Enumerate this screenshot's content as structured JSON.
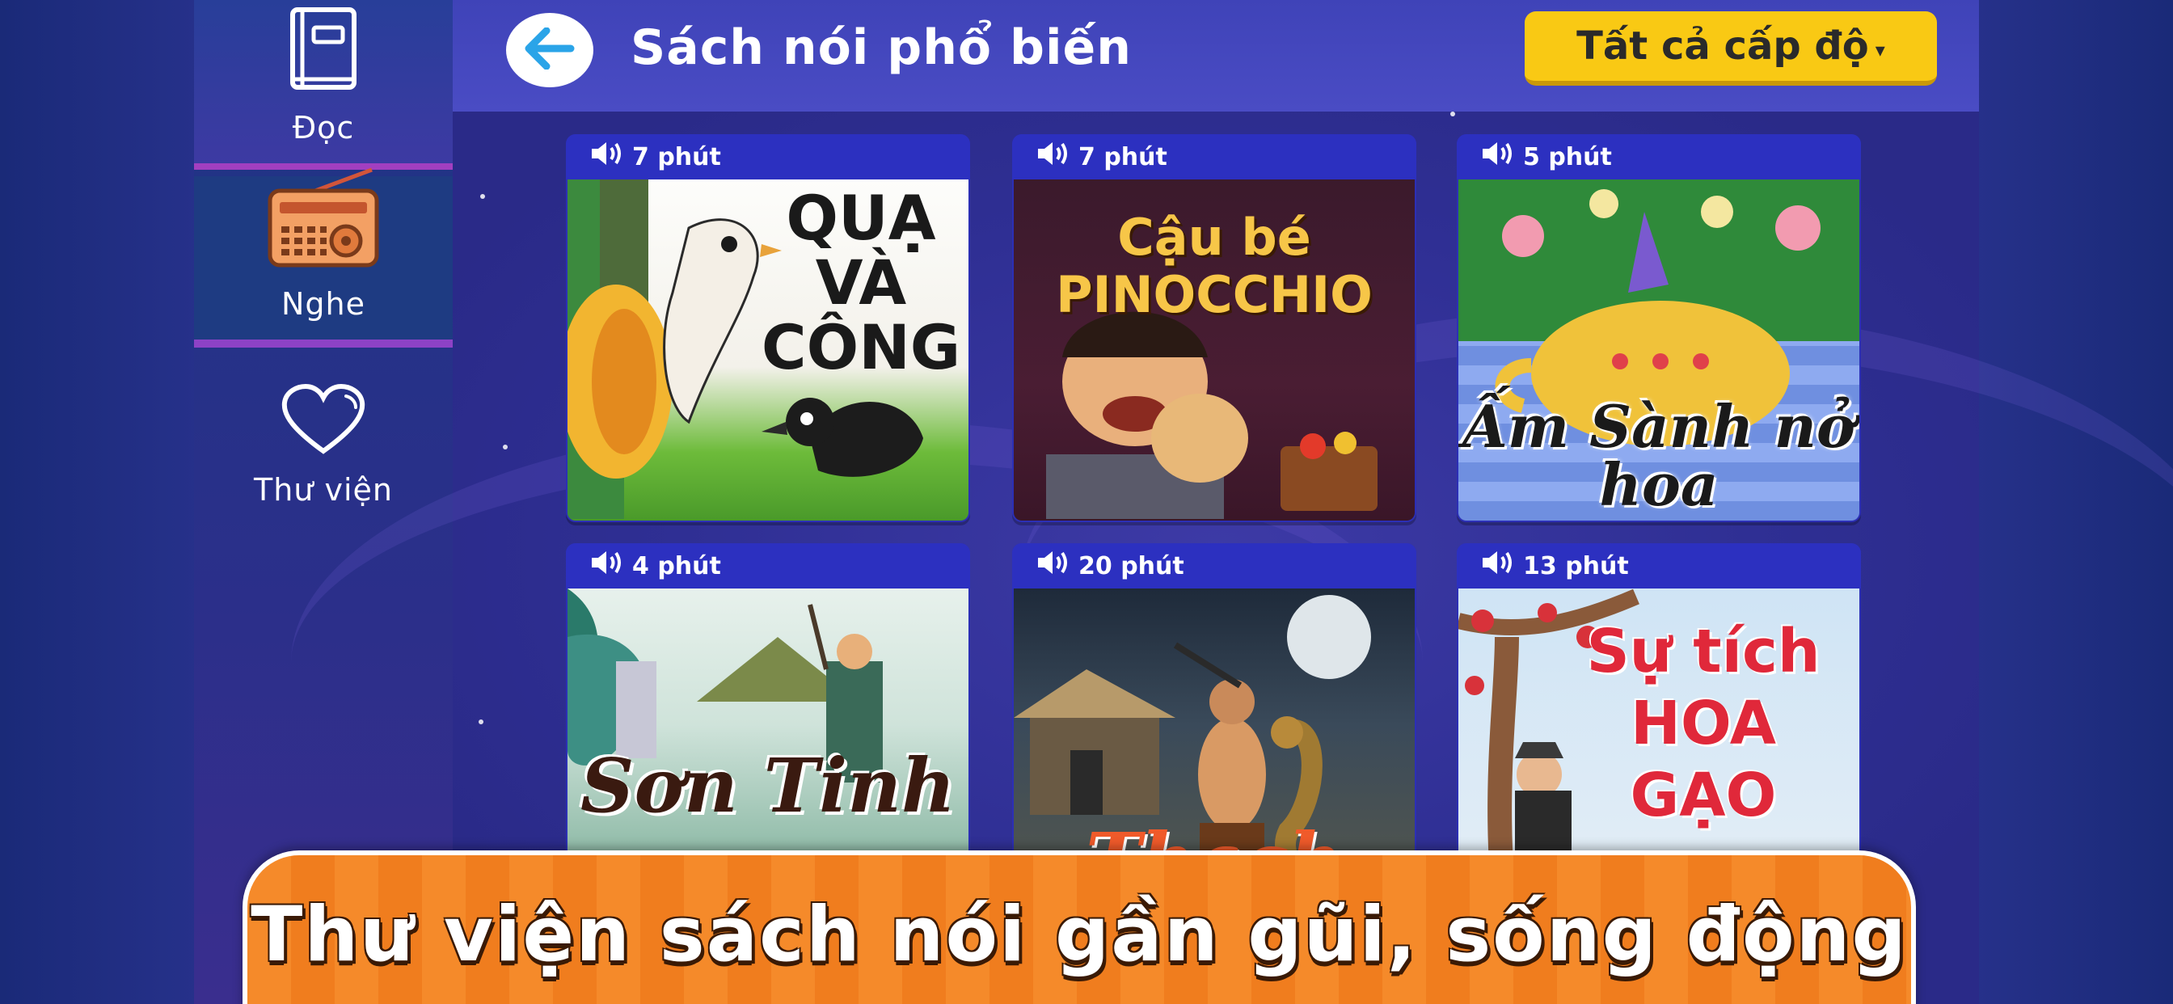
{
  "sidebar": {
    "items": [
      {
        "label": "Đọc",
        "icon": "book-icon"
      },
      {
        "label": "Nghe",
        "icon": "radio-icon"
      },
      {
        "label": "Thư viện",
        "icon": "heart-icon"
      }
    ]
  },
  "header": {
    "title": "Sách nói phổ biến",
    "level_filter": "Tất cả cấp độ",
    "level_caret": "▾"
  },
  "books": [
    {
      "duration": "7 phút",
      "cover_title": "QUẠ VÀ CÔNG"
    },
    {
      "duration": "7 phút",
      "cover_title": "Cậu bé PINOCCHIO"
    },
    {
      "duration": "5 phút",
      "cover_title": "Ấm Sành nở hoa"
    },
    {
      "duration": "4 phút",
      "cover_title": "Sơn Tinh"
    },
    {
      "duration": "20 phút",
      "cover_title": "Thạch Sanh"
    },
    {
      "duration": "13 phút",
      "cover_title": "Sự tích HOA GẠO"
    }
  ],
  "banner": {
    "text": "Thư viện sách nói gần gũi, sống động"
  },
  "colors": {
    "accent_yellow": "#f9c914",
    "banner_orange": "#f58a2a",
    "card_blue": "#2c30c0",
    "header_blue": "#4a4cc4"
  }
}
